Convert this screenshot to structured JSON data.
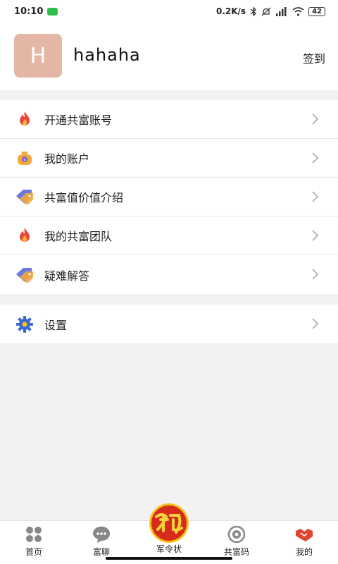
{
  "status_bar": {
    "time": "10:10",
    "network_speed": "0.2K/s",
    "battery": "42"
  },
  "profile": {
    "avatar_letter": "H",
    "username": "hahaha",
    "checkin_label": "签到"
  },
  "menu_group_1": [
    {
      "label": "开通共富账号",
      "icon": "fire-icon"
    },
    {
      "label": "我的账户",
      "icon": "money-bag-icon"
    },
    {
      "label": "共富值价值介绍",
      "icon": "tag-icon"
    },
    {
      "label": "我的共富团队",
      "icon": "fire-icon"
    },
    {
      "label": "疑难解答",
      "icon": "tag-icon"
    }
  ],
  "menu_group_2": [
    {
      "label": "设置",
      "icon": "gear-icon"
    }
  ],
  "bottom_nav": {
    "tabs": [
      {
        "label": "首页",
        "icon": "grid-icon"
      },
      {
        "label": "富聊",
        "icon": "chat-icon"
      },
      {
        "label": "军令状",
        "icon": "badge-icon"
      },
      {
        "label": "共富码",
        "icon": "target-icon"
      },
      {
        "label": "我的",
        "icon": "handshake-icon"
      }
    ]
  },
  "colors": {
    "avatar_bg": "#e4b6a6",
    "badge_red": "#d72b1b",
    "page_bg": "#f2f2f4"
  }
}
